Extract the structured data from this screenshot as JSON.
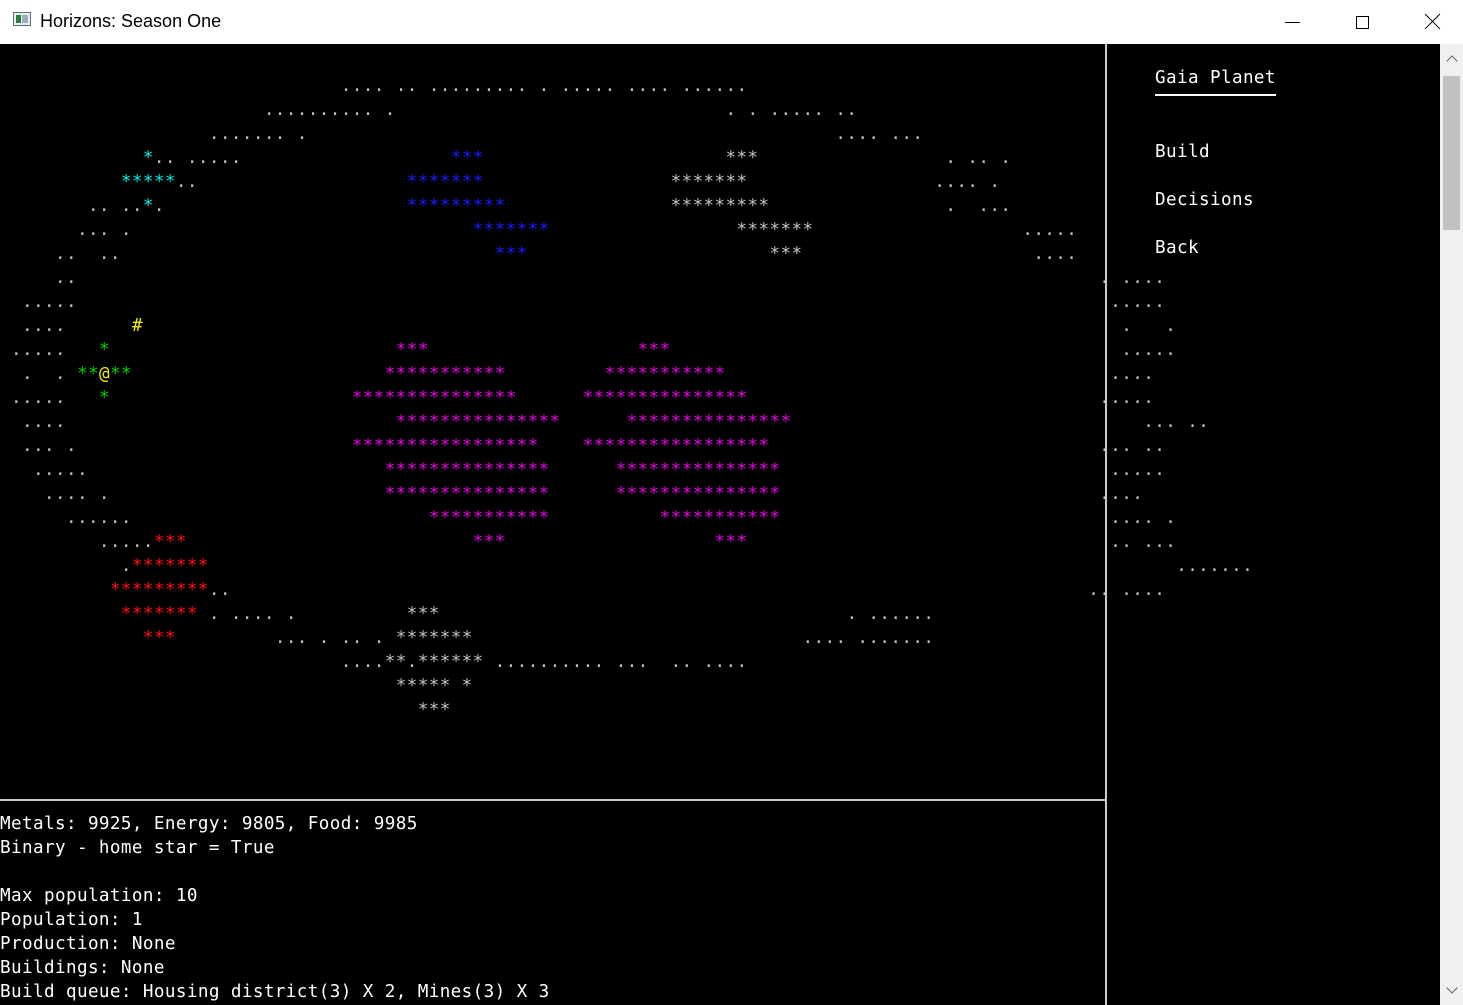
{
  "window": {
    "title": "Horizons: Season One",
    "icon": "app-window-icon",
    "controls": [
      "minimize-icon",
      "maximize-icon",
      "close-icon"
    ]
  },
  "colors": {
    "background": "#000000",
    "dots": "#c0c0c0",
    "cyan": "#00e8e8",
    "blue": "#1a1aff",
    "magenta": "#e000e0",
    "green": "#00d000",
    "yellow": "#f0f000",
    "red": "#ff1010"
  },
  "map": {
    "lines": [
      [
        [
          "                               .... .. ......... . ..... .... ......",
          "w"
        ]
      ],
      [
        [
          "                        .......... .                              . . ..... ..",
          "w"
        ]
      ],
      [
        [
          "                   ....... .                                                .... ...",
          "w"
        ]
      ],
      [
        [
          "             ",
          "w"
        ],
        [
          "*",
          "c"
        ],
        [
          "..",
          "w"
        ],
        [
          " .....                   ",
          "w"
        ],
        [
          "***",
          "b"
        ],
        [
          "                      ",
          "w"
        ],
        [
          "***",
          "w"
        ],
        [
          "                 . .. .",
          "w"
        ]
      ],
      [
        [
          "           ",
          "w"
        ],
        [
          "*****",
          "c"
        ],
        [
          "..",
          "w"
        ],
        [
          "                   ",
          "w"
        ],
        [
          "*******",
          "b"
        ],
        [
          "                 ",
          "w"
        ],
        [
          "*******",
          "w"
        ],
        [
          "                 .... .",
          "w"
        ]
      ],
      [
        [
          "        .. ..",
          "w"
        ],
        [
          "*",
          "c"
        ],
        [
          ".",
          "w"
        ],
        [
          "                      ",
          "w"
        ],
        [
          "*********",
          "b"
        ],
        [
          "               ",
          "w"
        ],
        [
          "*********",
          "w"
        ],
        [
          "                .  ...",
          "w"
        ]
      ],
      [
        [
          "       ... .",
          "w"
        ],
        [
          "                               ",
          "w"
        ],
        [
          "*******",
          "b"
        ],
        [
          "                 ",
          "w"
        ],
        [
          "*******",
          "w"
        ],
        [
          "                   .....",
          "w"
        ]
      ],
      [
        [
          "     ..  ..",
          "w"
        ],
        [
          "                                  ",
          "w"
        ],
        [
          "***",
          "b"
        ],
        [
          "                      ",
          "w"
        ],
        [
          "***",
          "w"
        ],
        [
          "                     ....",
          "w"
        ]
      ],
      [
        [
          "     ..",
          "w"
        ],
        [
          "                                                                                             . ....",
          "w"
        ]
      ],
      [
        [
          "  .....",
          "w"
        ],
        [
          "                                                                                              .....",
          "w"
        ]
      ],
      [
        [
          "  ....",
          "w"
        ],
        [
          "      ",
          "w"
        ],
        [
          "#",
          "y"
        ],
        [
          "                                                                                         .   .",
          "w"
        ]
      ],
      [
        [
          " .....",
          "w"
        ],
        [
          "   ",
          "w"
        ],
        [
          "*",
          "g"
        ],
        [
          "                          ",
          "w"
        ],
        [
          "***",
          "m"
        ],
        [
          "                   ",
          "w"
        ],
        [
          "***",
          "m"
        ],
        [
          "                                         .....",
          "w"
        ]
      ],
      [
        [
          "  .  .",
          "w"
        ],
        [
          " ",
          "w"
        ],
        [
          "**",
          "g"
        ],
        [
          "@",
          "y"
        ],
        [
          "**",
          "g"
        ],
        [
          "                       ",
          "w"
        ],
        [
          "***********",
          "m"
        ],
        [
          "         ",
          "w"
        ],
        [
          "***********",
          "m"
        ],
        [
          "                                   ....",
          "w"
        ]
      ],
      [
        [
          " .....",
          "w"
        ],
        [
          "   ",
          "w"
        ],
        [
          "*",
          "g"
        ],
        [
          "                      ",
          "w"
        ],
        [
          "***************",
          "m"
        ],
        [
          "      ",
          "w"
        ],
        [
          "***************",
          "m"
        ],
        [
          "                                .....",
          "w"
        ]
      ],
      [
        [
          "  ....",
          "w"
        ],
        [
          "                              ",
          "w"
        ],
        [
          "***************",
          "m"
        ],
        [
          "      ",
          "w"
        ],
        [
          "***************",
          "m"
        ],
        [
          "                                ... ..",
          "w"
        ]
      ],
      [
        [
          "  ... .",
          "w"
        ],
        [
          "                         ",
          "w"
        ],
        [
          "*****************",
          "m"
        ],
        [
          "    ",
          "w"
        ],
        [
          "*****************",
          "m"
        ],
        [
          "                              ... ..",
          "w"
        ]
      ],
      [
        [
          "   .....",
          "w"
        ],
        [
          "                           ",
          "w"
        ],
        [
          "***************",
          "m"
        ],
        [
          "      ",
          "w"
        ],
        [
          "***************",
          "m"
        ],
        [
          "                              .....",
          "w"
        ]
      ],
      [
        [
          "    .... .",
          "w"
        ],
        [
          "                         ",
          "w"
        ],
        [
          "***************",
          "m"
        ],
        [
          "      ",
          "w"
        ],
        [
          "***************",
          "m"
        ],
        [
          "                             ....",
          "w"
        ]
      ],
      [
        [
          "      ......",
          "w"
        ],
        [
          "                           ",
          "w"
        ],
        [
          "***********",
          "m"
        ],
        [
          "          ",
          "w"
        ],
        [
          "***********",
          "m"
        ],
        [
          "                              .... .",
          "w"
        ]
      ],
      [
        [
          "         .....",
          "w"
        ],
        [
          "***",
          "r"
        ],
        [
          "                          ",
          "w"
        ],
        [
          "***",
          "m"
        ],
        [
          "                   ",
          "w"
        ],
        [
          "***",
          "m"
        ],
        [
          "                                 .. ...",
          "w"
        ]
      ],
      [
        [
          "           .",
          "w"
        ],
        [
          "*******",
          "r"
        ],
        [
          "                                                                                        .......",
          "w"
        ]
      ],
      [
        [
          "          ",
          "w"
        ],
        [
          "*********",
          "r"
        ],
        [
          "..",
          "w"
        ],
        [
          "                                                                              .. ....",
          "w"
        ]
      ],
      [
        [
          "           ",
          "w"
        ],
        [
          "*******",
          "r"
        ],
        [
          " . .... .",
          "w"
        ],
        [
          "          ",
          "w"
        ],
        [
          "***",
          "w"
        ],
        [
          "                                     . ......",
          "w"
        ]
      ],
      [
        [
          "             ",
          "w"
        ],
        [
          "***",
          "r"
        ],
        [
          "         ... . .. .",
          "w"
        ],
        [
          " *******",
          "w"
        ],
        [
          "                              .... .......",
          "w"
        ]
      ],
      [
        [
          "                               ....",
          "w"
        ],
        [
          "**.******",
          "w"
        ],
        [
          " .......... ...  .. ....",
          "w"
        ]
      ],
      [
        [
          "                                    ***** *",
          "w"
        ]
      ],
      [
        [
          "                                      ***",
          "w"
        ]
      ]
    ]
  },
  "info": {
    "resources": "Metals: 9925, Energy: 9805, Food: 9985",
    "binary": "Binary - home star = True",
    "blank": "",
    "max_population": "Max population: 10",
    "population": "Population: 1",
    "production": "Production: None",
    "buildings": "Buildings: None",
    "build_queue": "Build queue: Housing district(3) X 2, Mines(3) X 3"
  },
  "menu": {
    "title": "Gaia Planet",
    "items": [
      {
        "label": "Build",
        "name": "menu-item-build"
      },
      {
        "label": "Decisions",
        "name": "menu-item-decisions"
      },
      {
        "label": "Back",
        "name": "menu-item-back"
      }
    ]
  },
  "scrollbar": {
    "up_icon": "scroll-up-chevron-icon",
    "down_icon": "scroll-down-chevron-icon"
  }
}
